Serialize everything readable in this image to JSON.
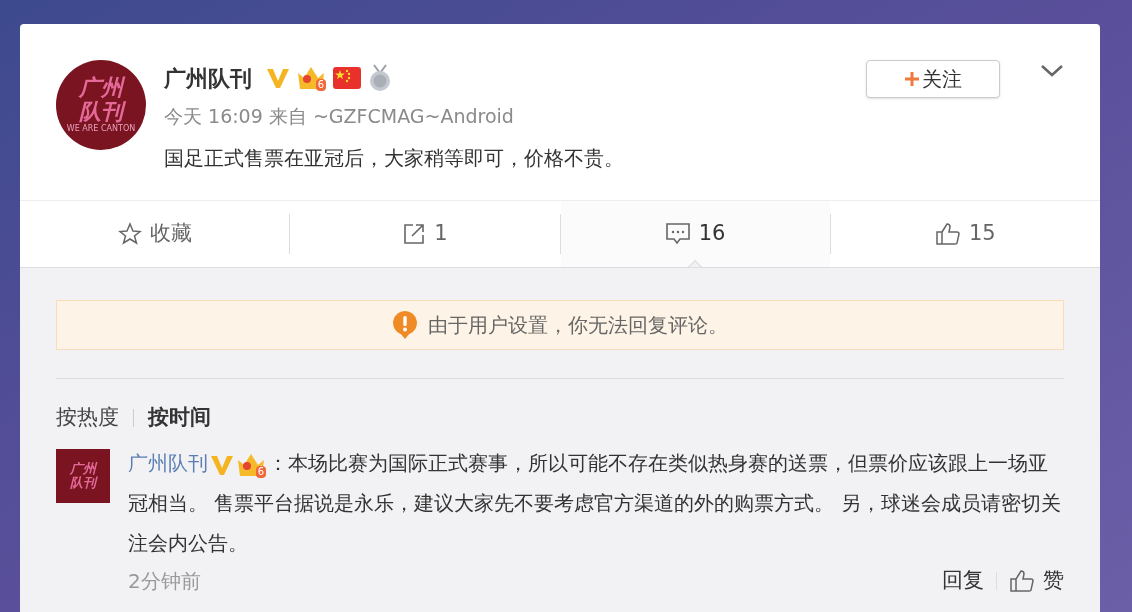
{
  "post": {
    "avatar_text": "广州队刊",
    "avatar_subtext": "WE ARE CANTON",
    "author": "广州队刊",
    "member_level": "6",
    "time": "今天 16:09",
    "source_prefix": "来自",
    "source": "~GZFCMAG~Android",
    "text": "国足正式售票在亚冠后，大家稍等即可，价格不贵。",
    "follow_label": "关注"
  },
  "actions": [
    {
      "kind": "favorite",
      "label": "收藏",
      "selected": false
    },
    {
      "kind": "share",
      "label": "1",
      "selected": false
    },
    {
      "kind": "comment",
      "label": "16",
      "selected": true
    },
    {
      "kind": "like",
      "label": "15",
      "selected": false
    }
  ],
  "notice": "由于用户设置，你无法回复评论。",
  "sort_tabs": [
    {
      "label": "按热度",
      "selected": false
    },
    {
      "label": "按时间",
      "selected": true
    }
  ],
  "comments": [
    {
      "avatar_text": "广州队刊",
      "author": "广州队刊",
      "member_level": "6",
      "text": "：本场比赛为国际正式赛事，所以可能不存在类似热身赛的送票，但票价应该跟上一场亚冠相当。 售票平台据说是永乐，建议大家先不要考虑官方渠道的外的购票方式。 另，球迷会成员请密切关注会内公告。",
      "time": "2分钟前",
      "reply_label": "回复",
      "like_label": "赞"
    }
  ]
}
